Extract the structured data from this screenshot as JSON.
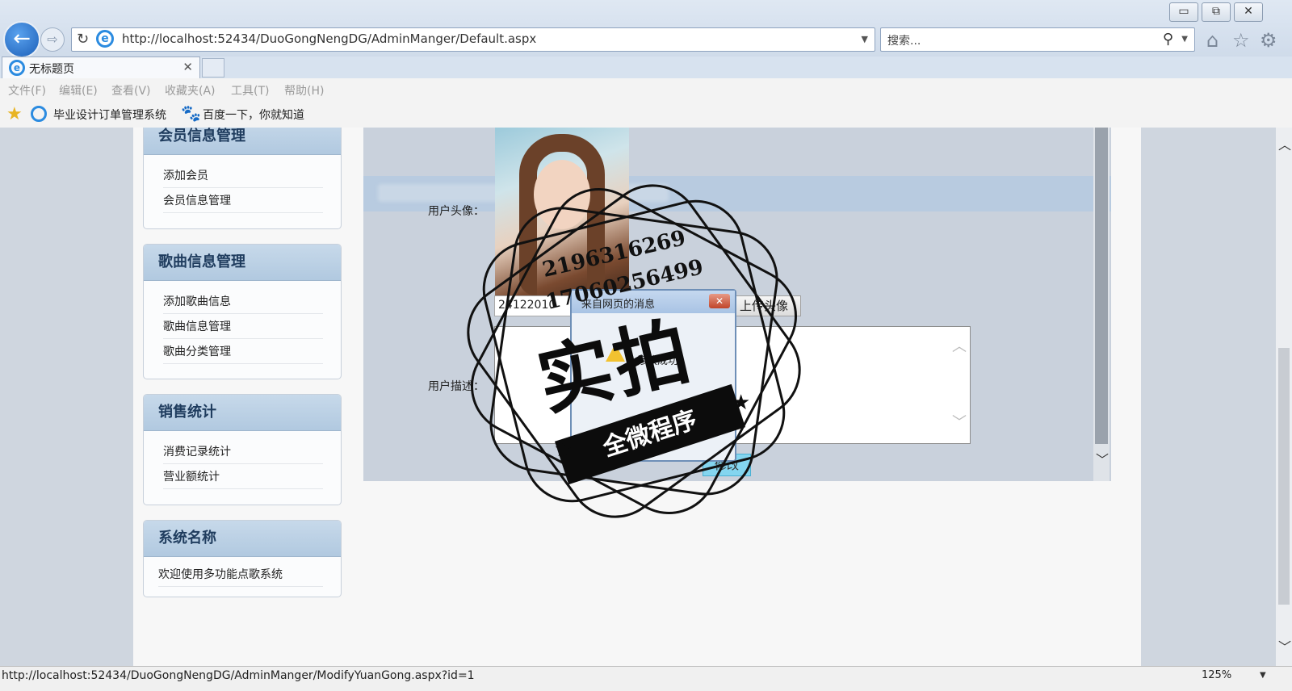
{
  "window": {
    "minimize_glyph": "▭",
    "restore_glyph": "⧉",
    "close_glyph": "✕"
  },
  "nav": {
    "back_glyph": "←",
    "forward_glyph": "⇨",
    "refresh_glyph": "↻",
    "address": "http://localhost:52434/DuoGongNengDG/AdminManger/Default.aspx",
    "search_placeholder": "搜索...",
    "search_glyph": "⚲",
    "home_glyph": "⌂",
    "star_glyph": "☆",
    "gear_glyph": "⚙"
  },
  "tab": {
    "title": "无标题页",
    "close_glyph": "✕"
  },
  "menu": [
    "文件(F)",
    "编辑(E)",
    "查看(V)",
    "收藏夹(A)",
    "工具(T)",
    "帮助(H)"
  ],
  "favorites": {
    "item1": "毕业设计订单管理系统",
    "item2": "百度一下，你就知道"
  },
  "sidebar": {
    "sections": [
      {
        "title": "会员信息管理",
        "items": [
          "添加会员",
          "会员信息管理"
        ]
      },
      {
        "title": "歌曲信息管理",
        "items": [
          "添加歌曲信息",
          "歌曲信息管理",
          "歌曲分类管理"
        ]
      },
      {
        "title": "销售统计",
        "items": [
          "消费记录统计",
          "营业额统计"
        ]
      },
      {
        "title": "系统名称",
        "items": [
          "欢迎使用多功能点歌系统"
        ]
      }
    ]
  },
  "form": {
    "avatar_label": "用户头像：",
    "file_value": "24122010",
    "upload_button": "上传头像",
    "desc_label": "用户描述：",
    "modify_button": "修改"
  },
  "alert": {
    "title": "来自网页的消息",
    "message": "修改成功"
  },
  "watermark": {
    "phone1": "2196316269",
    "phone2": "17060256499",
    "big": "实拍",
    "ribbon": "全微程序"
  },
  "status": {
    "url": "http://localhost:52434/DuoGongNengDG/AdminManger/ModifyYuanGong.aspx?id=1",
    "zoom": "125%"
  }
}
